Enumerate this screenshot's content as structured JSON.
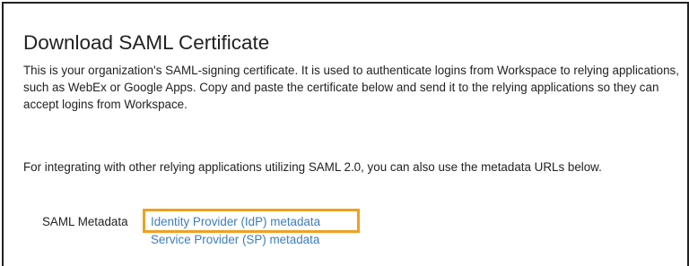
{
  "page": {
    "title": "Download SAML Certificate",
    "description": "This is your organization's SAML-signing certificate. It is used to authenticate logins from Workspace to relying applications, such as WebEx or Google Apps. Copy and paste the certificate below and send it to the relying applications so they can accept logins from Workspace.",
    "integration_note": "For integrating with other relying applications utilizing SAML 2.0, you can also use the metadata URLs below."
  },
  "metadata": {
    "label": "SAML Metadata",
    "links": [
      {
        "label": "Identity Provider (IdP) metadata",
        "highlighted": true
      },
      {
        "label": "Service Provider (SP) metadata",
        "highlighted": false
      }
    ]
  },
  "colors": {
    "link": "#3b7dc4",
    "highlight": "#f0a020",
    "text": "#222222"
  }
}
